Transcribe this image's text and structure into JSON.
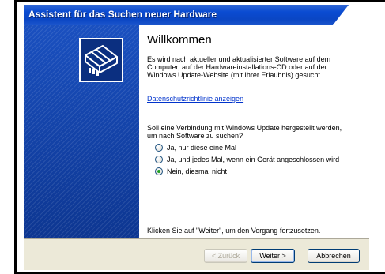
{
  "window": {
    "title": "Assistent für das Suchen neuer Hardware"
  },
  "content": {
    "heading": "Willkommen",
    "intro_lines": [
      "Es wird nach aktueller und aktualisierter Software auf dem",
      "Computer, auf der Hardwareinstallations-CD oder auf der",
      "Windows Update-Website (mit Ihrer Erlaubnis) gesucht."
    ],
    "privacy_link": "Datenschutzrichtlinie anzeigen",
    "question_lines": [
      "Soll eine Verbindung mit Windows Update hergestellt werden,",
      "um nach Software zu suchen?"
    ],
    "options": [
      {
        "label": "Ja, nur diese eine Mal",
        "checked": false
      },
      {
        "label": "Ja, und jedes Mal, wenn ein Gerät angeschlossen wird",
        "checked": false
      },
      {
        "label": "Nein, diesmal nicht",
        "checked": true
      }
    ],
    "footer_hint": "Klicken Sie auf \"Weiter\", um den Vorgang fortzusetzen."
  },
  "buttons": {
    "back": "< Zurück",
    "next": "Weiter >",
    "cancel": "Abbrechen"
  },
  "colors": {
    "titlebar": "#0a4bd2",
    "left_panel": "#0f3ea2",
    "link": "#0033cc",
    "radio_checked": "#21a121"
  },
  "icons": {
    "wizard": "hardware-card-icon"
  }
}
